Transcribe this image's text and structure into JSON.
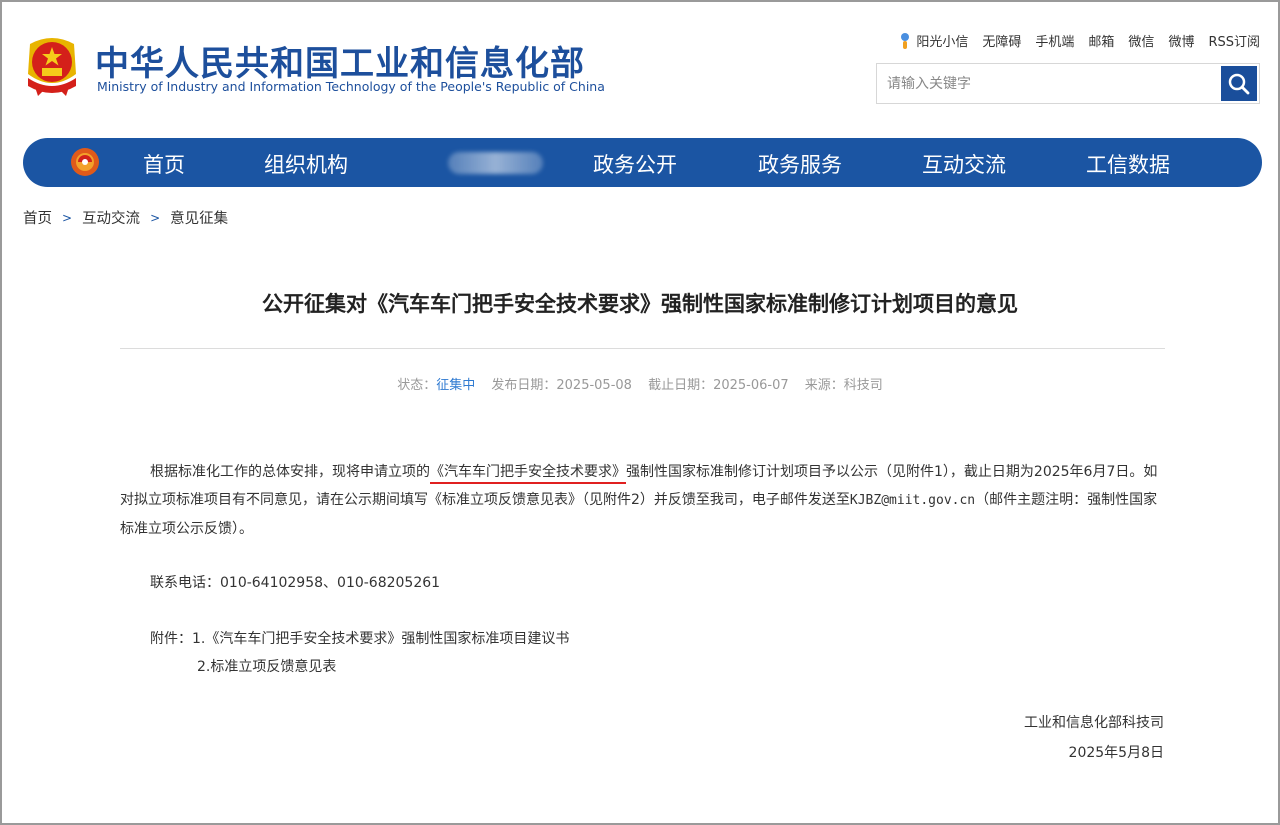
{
  "header": {
    "title_cn": "中华人民共和国工业和信息化部",
    "title_en": "Ministry of Industry and Information Technology of the People's Republic of China",
    "emblem_icon": "national-emblem-icon"
  },
  "top_links": [
    "阳光小信",
    "无障碍",
    "手机端",
    "邮箱",
    "微信",
    "微博",
    "RSS订阅"
  ],
  "search": {
    "placeholder": "请输入关键字",
    "icon": "search-icon"
  },
  "nav": {
    "logo_icon": "miit-logo-icon",
    "items": [
      "首页",
      "组织机构",
      "政务公开",
      "政务服务",
      "互动交流",
      "工信数据"
    ]
  },
  "breadcrumb": [
    "首页",
    "互动交流",
    "意见征集"
  ],
  "article": {
    "title": "公开征集对《汽车车门把手安全技术要求》强制性国家标准制修订计划项目的意见",
    "meta": {
      "status_label": "状态：",
      "status_value": "征集中",
      "publish": "发布日期：2025-05-08",
      "deadline": "截止日期：2025-06-07",
      "source": "来源：科技司"
    },
    "p1_pre": "根据标准化工作的总体安排，现将申请立项的",
    "p1_mark": "《汽车车门把手安全技术要求》",
    "p1_post": "强制性国家标准制修订计划项目予以公示（见附件1），截止日期为2025年6月7日。如对拟立项标准项目有不同意见，请在公示期间填写《标准立项反馈意见表》（见附件2）并反馈至我司，电子邮件发送至",
    "email": "KJBZ@miit.gov.cn",
    "p1_end": "（邮件主题注明：强制性国家标准立项公示反馈）。",
    "contact": "联系电话：010-64102958、010-68205261",
    "attach_1": "附件：1.《汽车车门把手安全技术要求》强制性国家标准项目建议书",
    "attach_2": "2.标准立项反馈意见表",
    "sign_org": "工业和信息化部科技司",
    "sign_date": "2025年5月8日"
  },
  "colors": {
    "brand_blue": "#1b55a3",
    "underline_red": "#e02020",
    "status_blue": "#2f7ad1"
  }
}
